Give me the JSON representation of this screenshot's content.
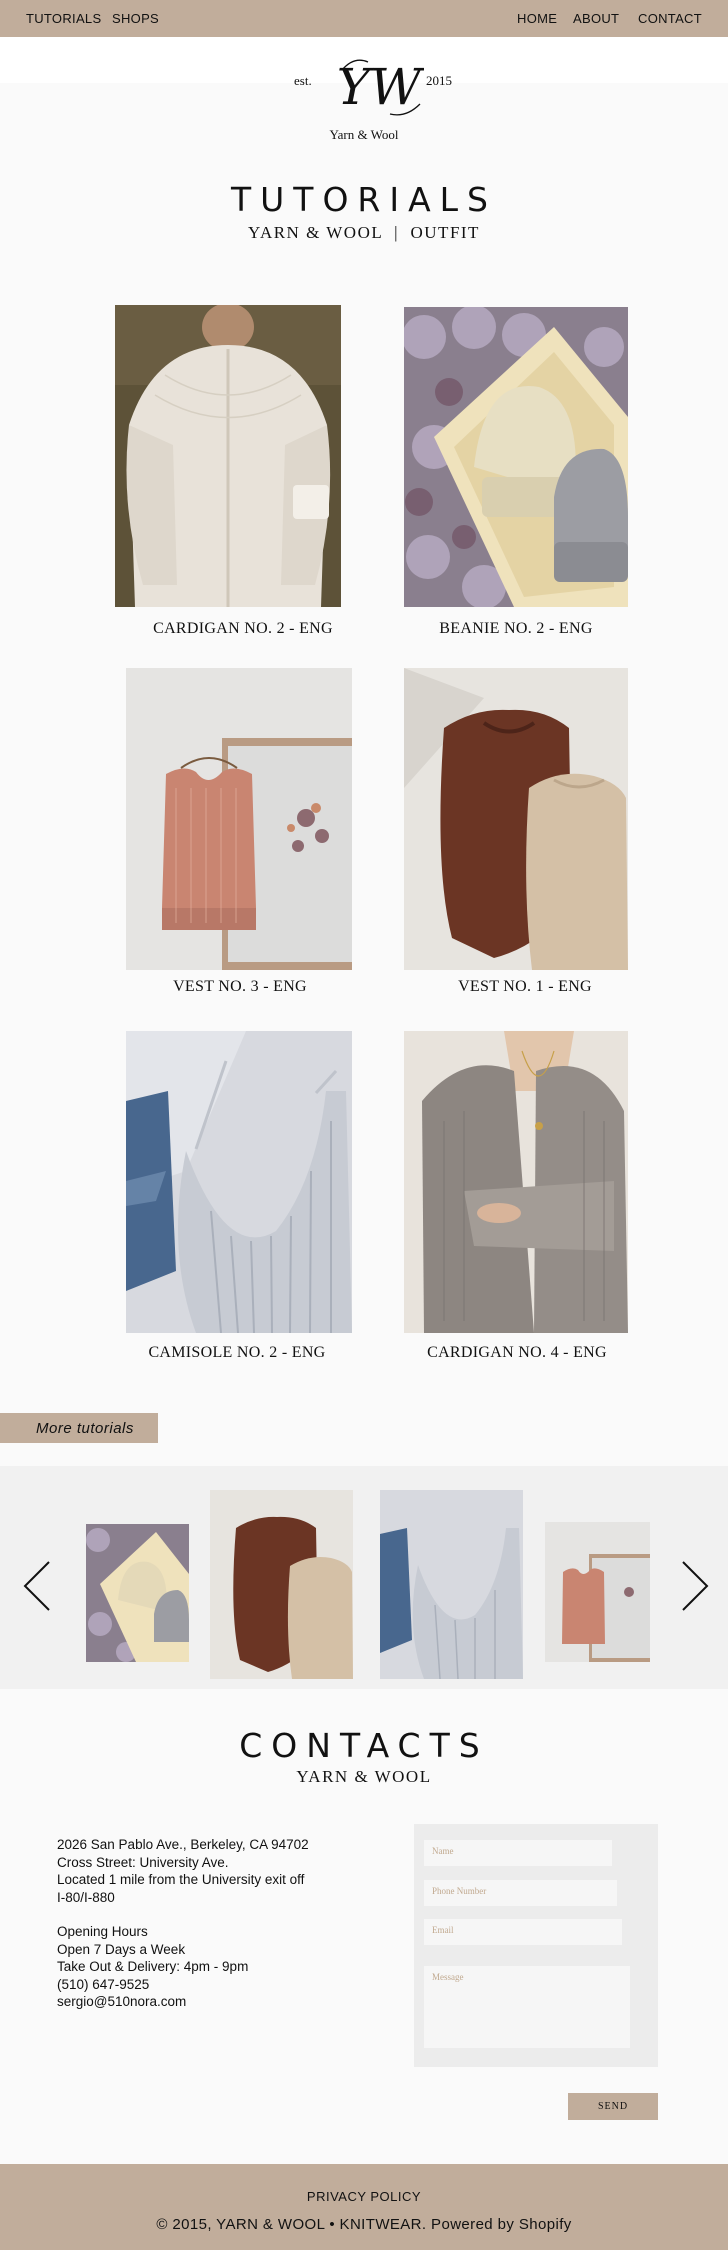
{
  "nav": {
    "left": [
      "TUTORIALS",
      "SHOPS"
    ],
    "right": [
      "HOME",
      "ABOUT",
      "CONTACT"
    ]
  },
  "logo": {
    "est": "est.",
    "year": "2015",
    "monogram": "YW",
    "brand": "Yarn & Wool"
  },
  "tutorials": {
    "title": "TUTORIALS",
    "subtitle": "YARN & WOOL  |  OUTFIT",
    "items": [
      {
        "label": "CARDIGAN NO. 2 - ENG"
      },
      {
        "label": "BEANIE NO. 2 - ENG"
      },
      {
        "label": "VEST NO. 3 - ENG"
      },
      {
        "label": "VEST NO. 1 - ENG"
      },
      {
        "label": "CAMISOLE NO. 2 - ENG"
      },
      {
        "label": "CARDIGAN NO. 4 - ENG"
      }
    ],
    "more_label": "More tutorials"
  },
  "carousel": {
    "prev_icon": "chevron-left-icon",
    "next_icon": "chevron-right-icon"
  },
  "contacts": {
    "title": "CONTACTS",
    "subtitle": "YARN & WOOL",
    "address_lines": [
      "2026 San Pablo Ave., Berkeley, CA 94702",
      "Cross Street: University Ave.",
      "Located 1 mile from the University exit off",
      "I-80/I-880"
    ],
    "hours_lines": [
      "Opening Hours",
      "Open 7 Days a Week",
      "Take Out & Delivery: 4pm - 9pm",
      "(510) 647-9525",
      "sergio@510nora.com"
    ],
    "form": {
      "name_placeholder": "Name",
      "phone_placeholder": "Phone Number",
      "email_placeholder": "Email",
      "message_placeholder": "Message",
      "send_label": "SEND"
    }
  },
  "footer": {
    "privacy": "PRIVACY POLICY",
    "copyright": "© 2015, YARN & WOOL • KNITWEAR. Powered by Shopify"
  },
  "colors": {
    "accent": "#c1ad9b",
    "background": "#fafafa",
    "carousel_bg": "#f1f1f1",
    "form_bg": "#ececec"
  }
}
